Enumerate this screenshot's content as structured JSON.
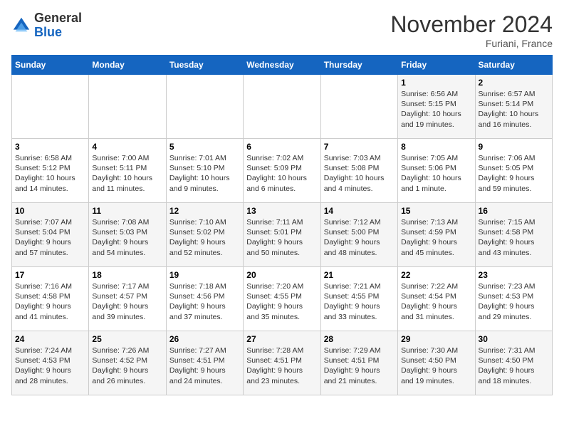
{
  "header": {
    "logo_line1": "General",
    "logo_line2": "Blue",
    "month": "November 2024",
    "location": "Furiani, France"
  },
  "weekdays": [
    "Sunday",
    "Monday",
    "Tuesday",
    "Wednesday",
    "Thursday",
    "Friday",
    "Saturday"
  ],
  "weeks": [
    [
      {
        "day": "",
        "info": ""
      },
      {
        "day": "",
        "info": ""
      },
      {
        "day": "",
        "info": ""
      },
      {
        "day": "",
        "info": ""
      },
      {
        "day": "",
        "info": ""
      },
      {
        "day": "1",
        "info": "Sunrise: 6:56 AM\nSunset: 5:15 PM\nDaylight: 10 hours\nand 19 minutes."
      },
      {
        "day": "2",
        "info": "Sunrise: 6:57 AM\nSunset: 5:14 PM\nDaylight: 10 hours\nand 16 minutes."
      }
    ],
    [
      {
        "day": "3",
        "info": "Sunrise: 6:58 AM\nSunset: 5:12 PM\nDaylight: 10 hours\nand 14 minutes."
      },
      {
        "day": "4",
        "info": "Sunrise: 7:00 AM\nSunset: 5:11 PM\nDaylight: 10 hours\nand 11 minutes."
      },
      {
        "day": "5",
        "info": "Sunrise: 7:01 AM\nSunset: 5:10 PM\nDaylight: 10 hours\nand 9 minutes."
      },
      {
        "day": "6",
        "info": "Sunrise: 7:02 AM\nSunset: 5:09 PM\nDaylight: 10 hours\nand 6 minutes."
      },
      {
        "day": "7",
        "info": "Sunrise: 7:03 AM\nSunset: 5:08 PM\nDaylight: 10 hours\nand 4 minutes."
      },
      {
        "day": "8",
        "info": "Sunrise: 7:05 AM\nSunset: 5:06 PM\nDaylight: 10 hours\nand 1 minute."
      },
      {
        "day": "9",
        "info": "Sunrise: 7:06 AM\nSunset: 5:05 PM\nDaylight: 9 hours\nand 59 minutes."
      }
    ],
    [
      {
        "day": "10",
        "info": "Sunrise: 7:07 AM\nSunset: 5:04 PM\nDaylight: 9 hours\nand 57 minutes."
      },
      {
        "day": "11",
        "info": "Sunrise: 7:08 AM\nSunset: 5:03 PM\nDaylight: 9 hours\nand 54 minutes."
      },
      {
        "day": "12",
        "info": "Sunrise: 7:10 AM\nSunset: 5:02 PM\nDaylight: 9 hours\nand 52 minutes."
      },
      {
        "day": "13",
        "info": "Sunrise: 7:11 AM\nSunset: 5:01 PM\nDaylight: 9 hours\nand 50 minutes."
      },
      {
        "day": "14",
        "info": "Sunrise: 7:12 AM\nSunset: 5:00 PM\nDaylight: 9 hours\nand 48 minutes."
      },
      {
        "day": "15",
        "info": "Sunrise: 7:13 AM\nSunset: 4:59 PM\nDaylight: 9 hours\nand 45 minutes."
      },
      {
        "day": "16",
        "info": "Sunrise: 7:15 AM\nSunset: 4:58 PM\nDaylight: 9 hours\nand 43 minutes."
      }
    ],
    [
      {
        "day": "17",
        "info": "Sunrise: 7:16 AM\nSunset: 4:58 PM\nDaylight: 9 hours\nand 41 minutes."
      },
      {
        "day": "18",
        "info": "Sunrise: 7:17 AM\nSunset: 4:57 PM\nDaylight: 9 hours\nand 39 minutes."
      },
      {
        "day": "19",
        "info": "Sunrise: 7:18 AM\nSunset: 4:56 PM\nDaylight: 9 hours\nand 37 minutes."
      },
      {
        "day": "20",
        "info": "Sunrise: 7:20 AM\nSunset: 4:55 PM\nDaylight: 9 hours\nand 35 minutes."
      },
      {
        "day": "21",
        "info": "Sunrise: 7:21 AM\nSunset: 4:55 PM\nDaylight: 9 hours\nand 33 minutes."
      },
      {
        "day": "22",
        "info": "Sunrise: 7:22 AM\nSunset: 4:54 PM\nDaylight: 9 hours\nand 31 minutes."
      },
      {
        "day": "23",
        "info": "Sunrise: 7:23 AM\nSunset: 4:53 PM\nDaylight: 9 hours\nand 29 minutes."
      }
    ],
    [
      {
        "day": "24",
        "info": "Sunrise: 7:24 AM\nSunset: 4:53 PM\nDaylight: 9 hours\nand 28 minutes."
      },
      {
        "day": "25",
        "info": "Sunrise: 7:26 AM\nSunset: 4:52 PM\nDaylight: 9 hours\nand 26 minutes."
      },
      {
        "day": "26",
        "info": "Sunrise: 7:27 AM\nSunset: 4:51 PM\nDaylight: 9 hours\nand 24 minutes."
      },
      {
        "day": "27",
        "info": "Sunrise: 7:28 AM\nSunset: 4:51 PM\nDaylight: 9 hours\nand 23 minutes."
      },
      {
        "day": "28",
        "info": "Sunrise: 7:29 AM\nSunset: 4:51 PM\nDaylight: 9 hours\nand 21 minutes."
      },
      {
        "day": "29",
        "info": "Sunrise: 7:30 AM\nSunset: 4:50 PM\nDaylight: 9 hours\nand 19 minutes."
      },
      {
        "day": "30",
        "info": "Sunrise: 7:31 AM\nSunset: 4:50 PM\nDaylight: 9 hours\nand 18 minutes."
      }
    ]
  ]
}
